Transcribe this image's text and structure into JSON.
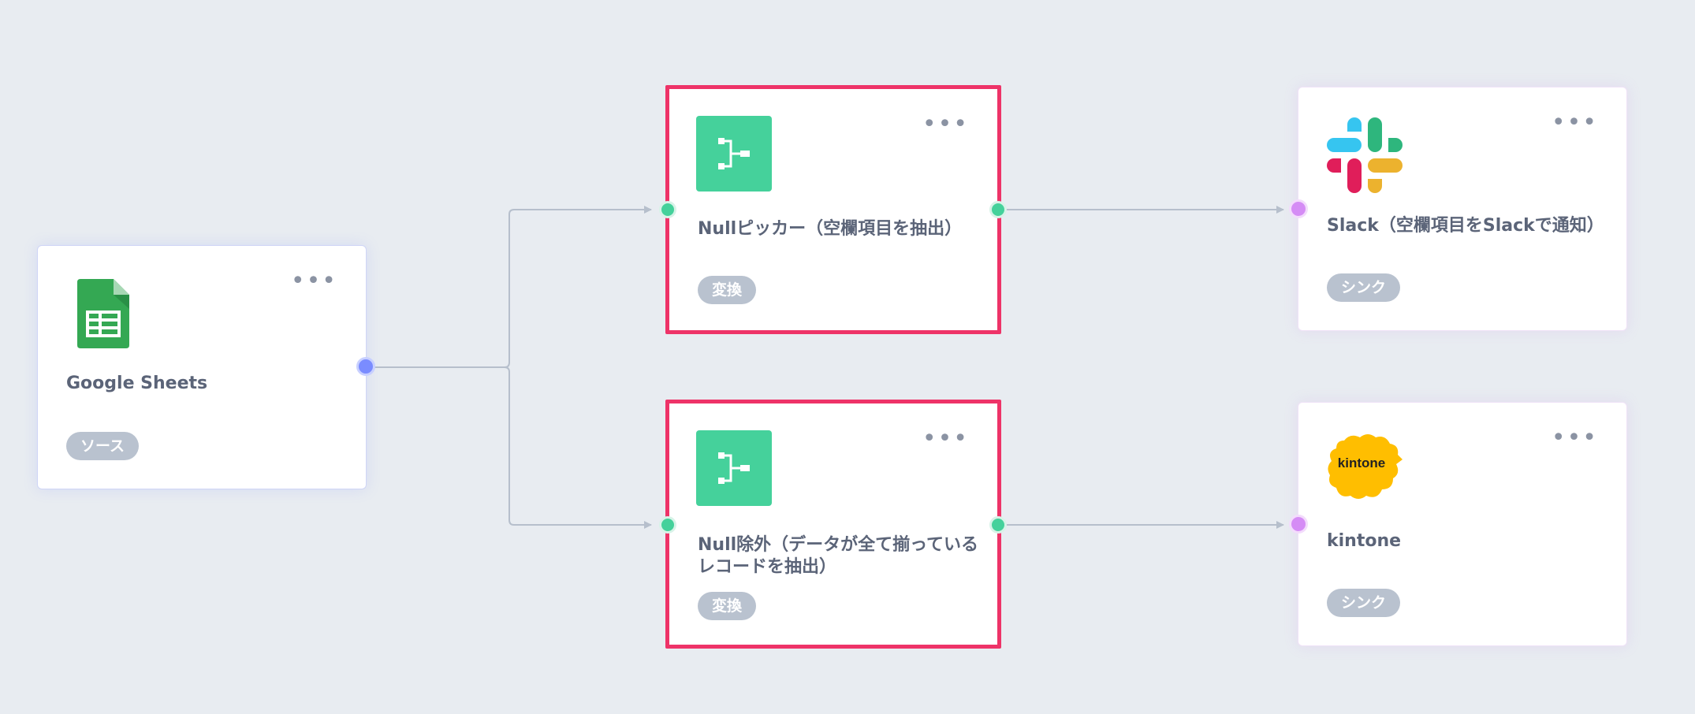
{
  "nodes": {
    "source": {
      "title": "Google Sheets",
      "badge": "ソース",
      "menu": "•••",
      "icon": "google-sheets-icon"
    },
    "transform1": {
      "title": "Nullピッカー（空欄項目を抽出）",
      "badge": "変換",
      "menu": "•••",
      "icon": "branch-transform-icon"
    },
    "transform2": {
      "title_line1": "Null除外（データが全て揃っている",
      "title_line2": "レコードを抽出）",
      "badge": "変換",
      "menu": "•••",
      "icon": "branch-transform-icon"
    },
    "sink1": {
      "title": "Slack（空欄項目をSlackで通知）",
      "badge": "シンク",
      "menu": "•••",
      "icon": "slack-logo-icon"
    },
    "sink2": {
      "title": "kintone",
      "badge": "シンク",
      "menu": "•••",
      "icon": "kintone-logo-icon",
      "logo_text": "kintone"
    }
  },
  "colors": {
    "background": "#e8ecf1",
    "selected_border": "#ee3368",
    "transform_icon": "#45d19b",
    "source_port": "#7a8cff",
    "sink_port": "#d58cf5",
    "badge": "#b9c2cf",
    "edge": "#b6bfcc"
  }
}
